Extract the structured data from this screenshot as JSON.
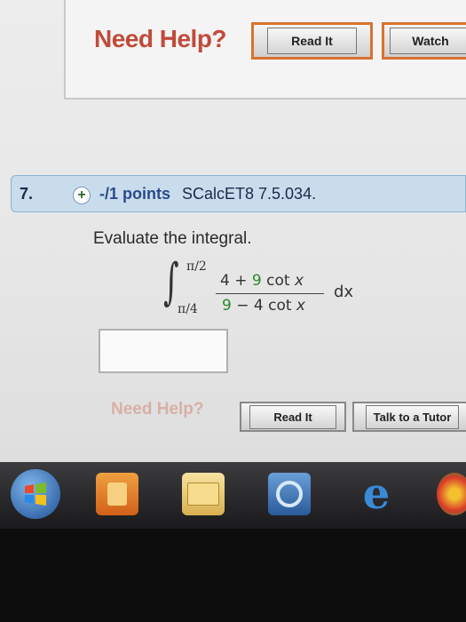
{
  "help_top": {
    "label": "Need Help?",
    "read_it": "Read It",
    "watch": "Watch"
  },
  "question": {
    "number": "7.",
    "points": "-/1 points",
    "code": "SCalcET8 7.5.034.",
    "prompt": "Evaluate the integral.",
    "upper_limit": "π/2",
    "lower_limit": "π/4",
    "numerator_a": "4 + ",
    "numerator_b": "9",
    "numerator_c": " cot ",
    "numerator_x": "x",
    "denominator_a": "9",
    "denominator_b": " − 4 cot ",
    "denominator_x": "x",
    "dx": "dx",
    "answer_value": ""
  },
  "help_bottom": {
    "label": "Need Help?",
    "read_it": "Read It",
    "talk": "Talk to a Tutor"
  },
  "taskbar": {
    "icons": [
      "windows-start-icon",
      "media-player-icon",
      "file-explorer-icon",
      "chrome-icon",
      "internet-explorer-icon"
    ]
  }
}
